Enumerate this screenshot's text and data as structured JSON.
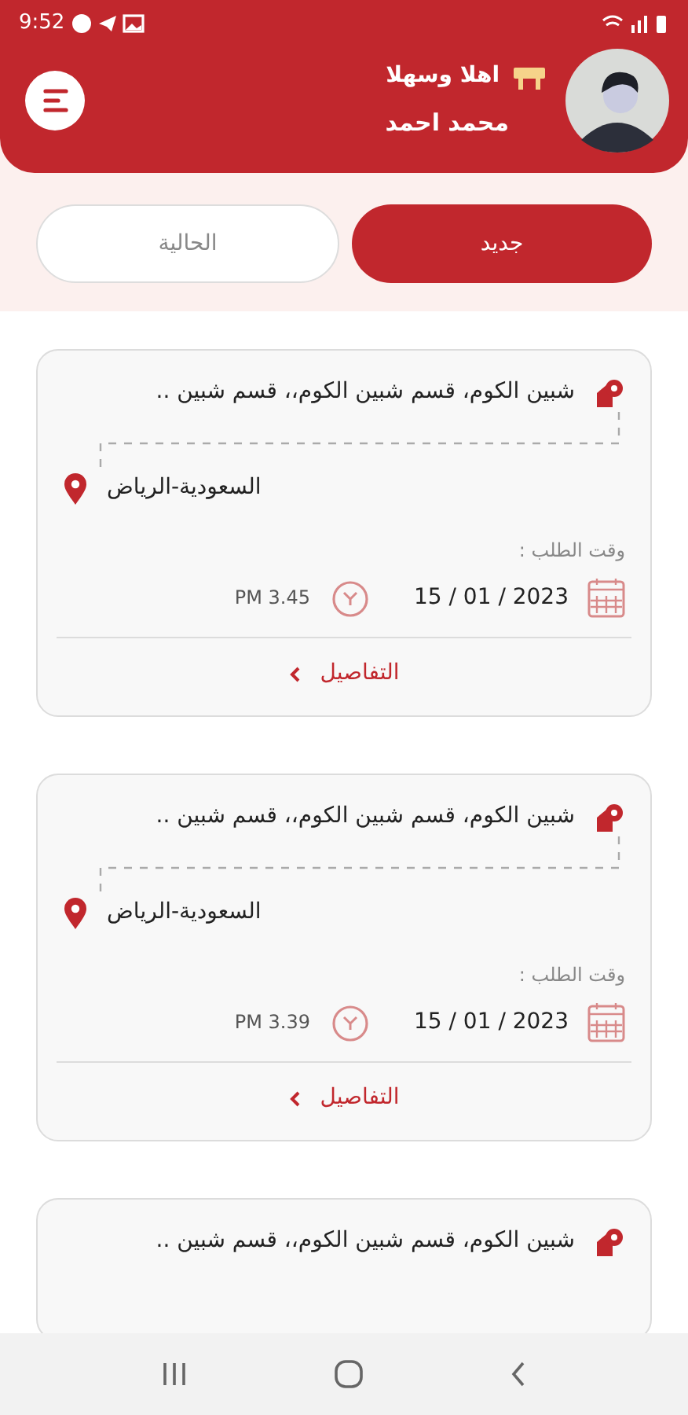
{
  "status_bar": {
    "time": "9:52"
  },
  "header": {
    "greeting": "اهلا وسهلا",
    "user_name": "محمد احمد"
  },
  "tabs": [
    {
      "label": "جديد",
      "selected": true
    },
    {
      "label": "الحالية",
      "selected": false
    }
  ],
  "orders": [
    {
      "from": "شبين الكوم، قسم شبين الكوم،، قسم شبين ..",
      "to": "السعودية-الرياض",
      "time_label": "وقت الطلب :",
      "date": "15 / 01 / 2023",
      "time": "PM 3.45",
      "details_link": "التفاصيل"
    },
    {
      "from": "شبين الكوم، قسم شبين الكوم،، قسم شبين ..",
      "to": "السعودية-الرياض",
      "time_label": "وقت الطلب :",
      "date": "15 / 01 / 2023",
      "time": "PM 3.39",
      "details_link": "التفاصيل"
    },
    {
      "from": "شبين الكوم، قسم شبين الكوم،، قسم شبين .."
    }
  ]
}
